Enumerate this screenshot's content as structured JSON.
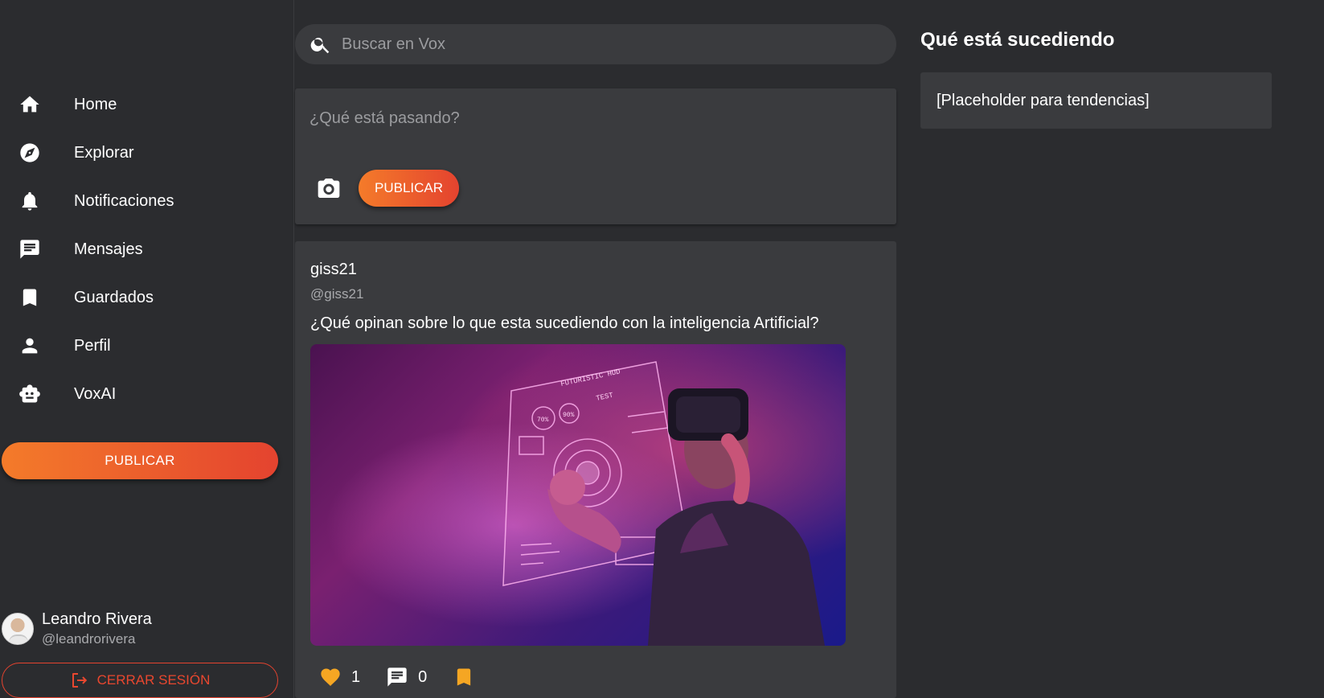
{
  "sidebar": {
    "items": [
      {
        "label": "Home",
        "icon": "home-icon"
      },
      {
        "label": "Explorar",
        "icon": "compass-icon"
      },
      {
        "label": "Notificaciones",
        "icon": "bell-icon"
      },
      {
        "label": "Mensajes",
        "icon": "chat-icon"
      },
      {
        "label": "Guardados",
        "icon": "bookmark-icon"
      },
      {
        "label": "Perfil",
        "icon": "person-icon"
      },
      {
        "label": "VoxAI",
        "icon": "robot-icon"
      }
    ],
    "publish_label": "PUBLICAR",
    "user": {
      "name": "Leandro Rivera",
      "handle": "@leandrorivera"
    },
    "logout_label": "CERRAR SESIÓN"
  },
  "search": {
    "placeholder": "Buscar en Vox"
  },
  "composer": {
    "placeholder": "¿Qué está pasando?",
    "publish_label": "PUBLICAR"
  },
  "post": {
    "author": "giss21",
    "handle": "@giss21",
    "text": "¿Qué opinan sobre lo que esta sucediendo con la inteligencia Artificial?",
    "likes": "1",
    "comments": "0",
    "hud": {
      "title": "FUTURISTIC HUD",
      "test": "TEST",
      "gauge1": "70%",
      "gauge2": "90%"
    }
  },
  "trends": {
    "title": "Qué está sucediendo",
    "placeholder": "[Placeholder para tendencias]"
  },
  "colors": {
    "background": "#2b2c2f",
    "card": "#3a3b3e",
    "accent_start": "#f47b2a",
    "accent_end": "#e4432f",
    "like": "#f5a623",
    "bookmark": "#f5a623"
  }
}
